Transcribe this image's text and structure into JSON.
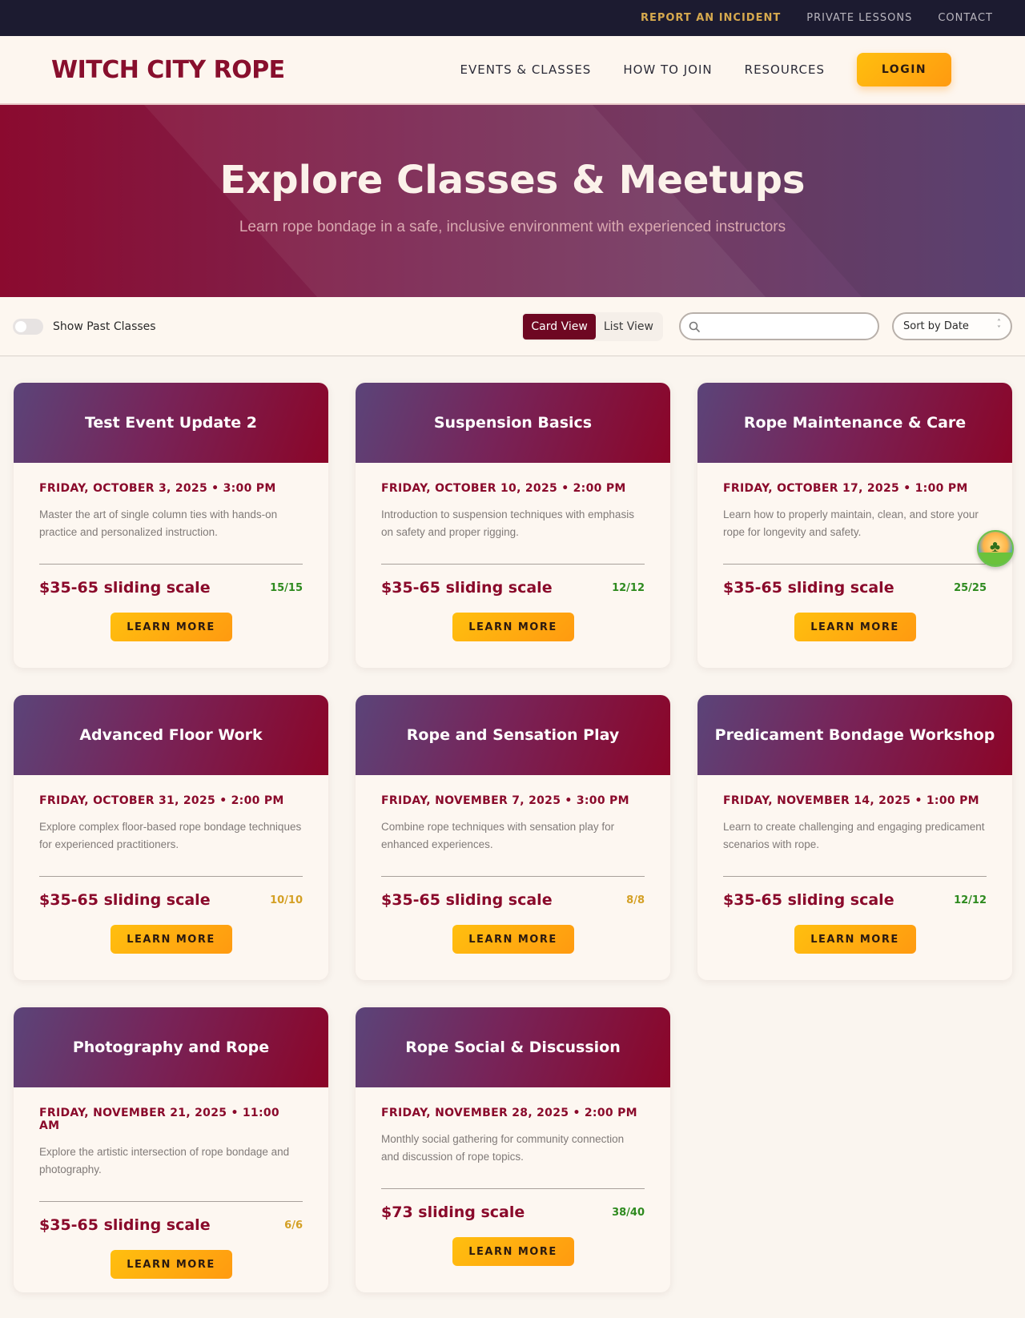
{
  "utility_nav": {
    "report_incident": "REPORT AN INCIDENT",
    "private_lessons": "PRIVATE LESSONS",
    "contact": "CONTACT"
  },
  "header": {
    "logo": "WITCH CITY ROPE",
    "nav": {
      "events_classes": "EVENTS & CLASSES",
      "how_to_join": "HOW TO JOIN",
      "resources": "RESOURCES"
    },
    "login": "LOGIN"
  },
  "hero": {
    "title": "Explore Classes & Meetups",
    "subtitle": "Learn rope bondage in a safe, inclusive environment with experienced instructors"
  },
  "filters": {
    "show_past_label": "Show Past Classes",
    "show_past_checked": false,
    "card_view": "Card View",
    "list_view": "List View",
    "active_view": "Card View",
    "search_placeholder": "",
    "search_value": "",
    "sort_value": "Sort by Date"
  },
  "events": [
    {
      "title": "Test Event Update 2",
      "date": "FRIDAY, OCTOBER 3, 2025 • 3:00 PM",
      "description": "Master the art of single column ties with hands-on practice and personalized instruction.",
      "price": "$35-65 sliding scale",
      "capacity": "15/15",
      "capacity_color": "#2e8a1f",
      "button": "LEARN MORE"
    },
    {
      "title": "Suspension Basics",
      "date": "FRIDAY, OCTOBER 10, 2025 • 2:00 PM",
      "description": "Introduction to suspension techniques with emphasis on safety and proper rigging.",
      "price": "$35-65 sliding scale",
      "capacity": "12/12",
      "capacity_color": "#2e8a1f",
      "button": "LEARN MORE"
    },
    {
      "title": "Rope Maintenance & Care",
      "date": "FRIDAY, OCTOBER 17, 2025 • 1:00 PM",
      "description": "Learn how to properly maintain, clean, and store your rope for longevity and safety.",
      "price": "$35-65 sliding scale",
      "capacity": "25/25",
      "capacity_color": "#2e8a1f",
      "button": "LEARN MORE"
    },
    {
      "title": "Advanced Floor Work",
      "date": "FRIDAY, OCTOBER 31, 2025 • 2:00 PM",
      "description": "Explore complex floor-based rope bondage techniques for experienced practitioners.",
      "price": "$35-65 sliding scale",
      "capacity": "10/10",
      "capacity_color": "#d4a025",
      "button": "LEARN MORE"
    },
    {
      "title": "Rope and Sensation Play",
      "date": "FRIDAY, NOVEMBER 7, 2025 • 3:00 PM",
      "description": "Combine rope techniques with sensation play for enhanced experiences.",
      "price": "$35-65 sliding scale",
      "capacity": "8/8",
      "capacity_color": "#d4a025",
      "button": "LEARN MORE"
    },
    {
      "title": "Predicament Bondage Workshop",
      "date": "FRIDAY, NOVEMBER 14, 2025 • 1:00 PM",
      "description": "Learn to create challenging and engaging predicament scenarios with rope.",
      "price": "$35-65 sliding scale",
      "capacity": "12/12",
      "capacity_color": "#2e8a1f",
      "button": "LEARN MORE"
    },
    {
      "title": "Photography and Rope",
      "date": "FRIDAY, NOVEMBER 21, 2025 • 11:00 AM",
      "description": "Explore the artistic intersection of rope bondage and photography.",
      "price": "$35-65 sliding scale",
      "capacity": "6/6",
      "capacity_color": "#d4a025",
      "button": "LEARN MORE"
    },
    {
      "title": "Rope Social & Discussion",
      "date": "FRIDAY, NOVEMBER 28, 2025 • 2:00 PM",
      "description": "Monthly social gathering for community connection and discussion of rope topics.",
      "price": "$73 sliding scale",
      "capacity": "38/40",
      "capacity_color": "#2e8a1f",
      "button": "LEARN MORE"
    }
  ],
  "colors": {
    "brand": "#880f2d",
    "accent": "#ffb010",
    "dark_bar": "#1c1b30"
  },
  "floating_widget": {
    "icon": "palm-island-icon"
  }
}
